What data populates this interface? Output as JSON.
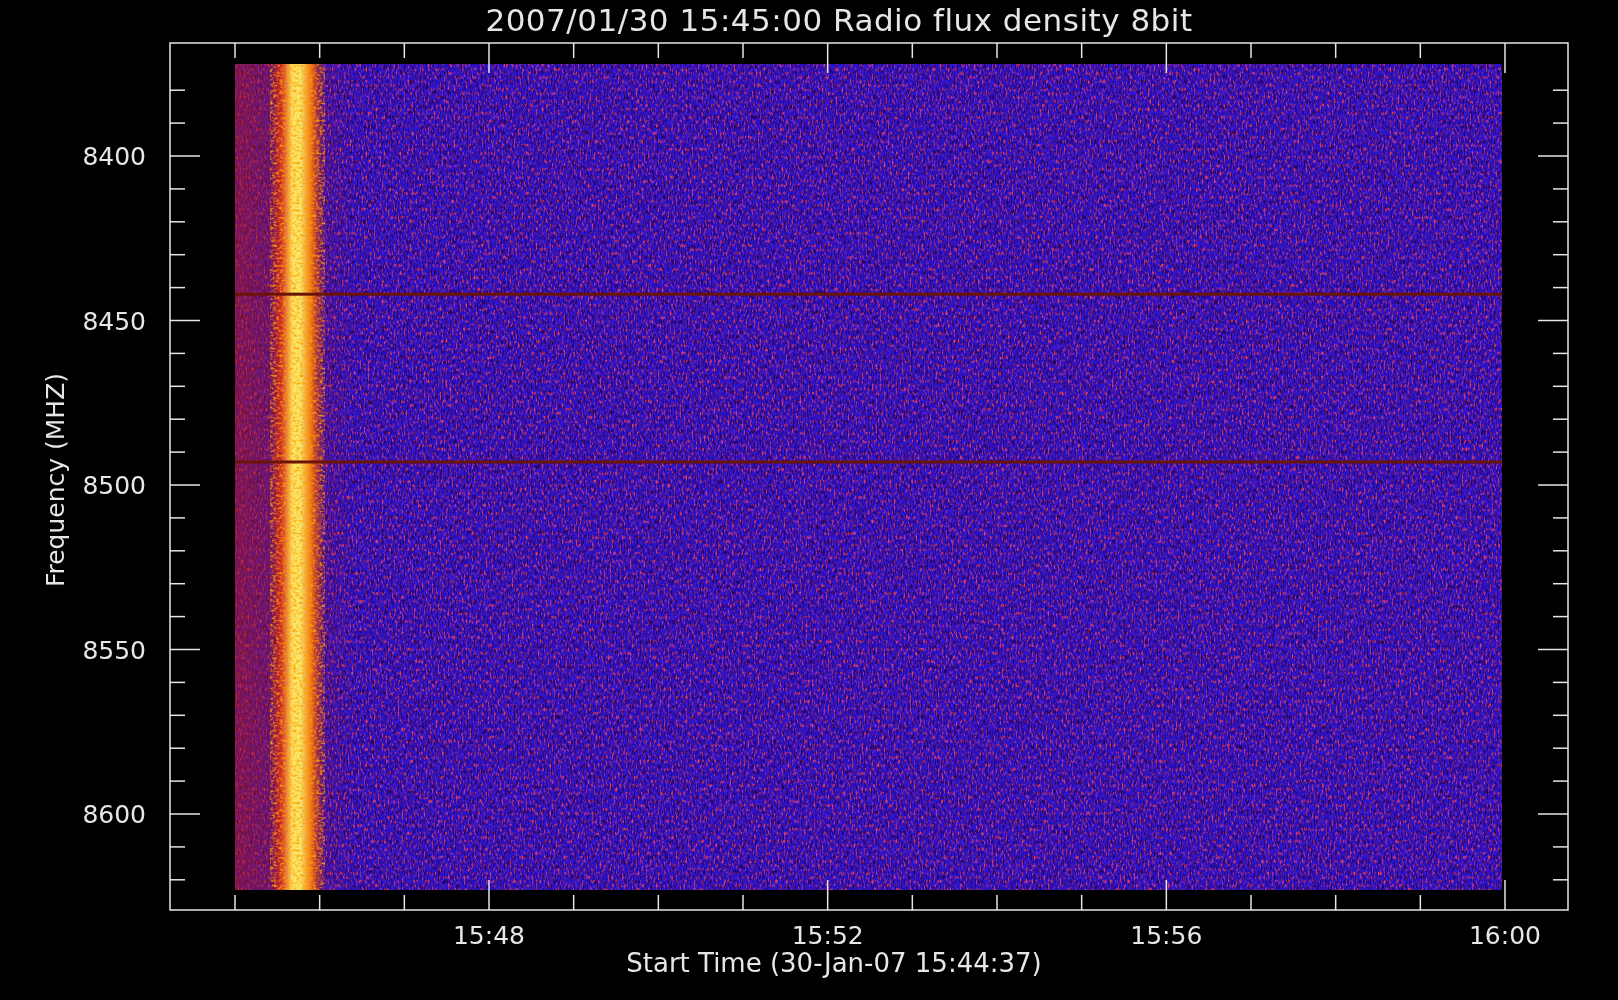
{
  "title": "2007/01/30 15:45:00 Radio flux density 8bit",
  "plot": {
    "ylabel": "Frequency (MHZ)",
    "yticks": [
      "8400",
      "8450",
      "8500",
      "8550",
      "8600"
    ],
    "xticks": [
      "15:48",
      "15:52",
      "15:56",
      "16:00"
    ],
    "xlabel": "Start Time (30-Jan-07 15:44:37)"
  }
}
